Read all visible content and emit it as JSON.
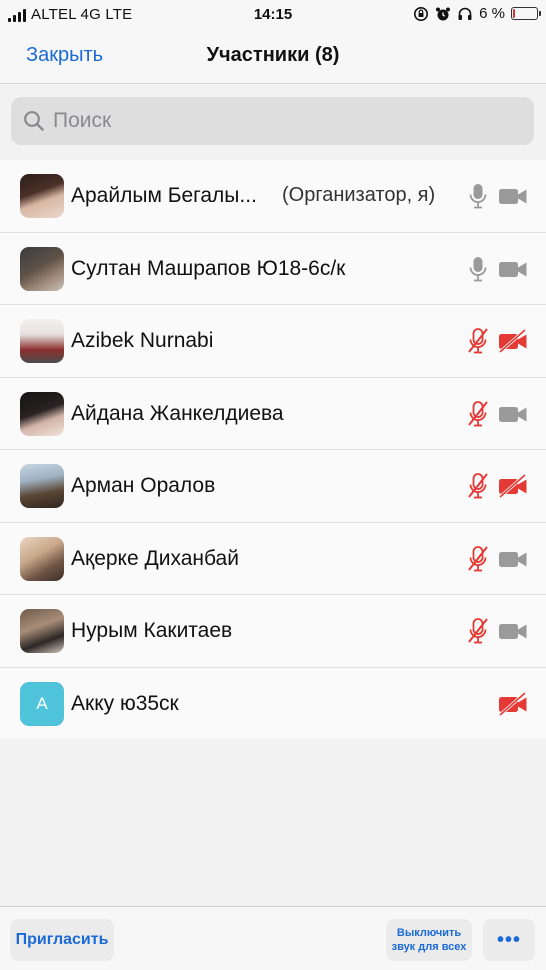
{
  "status_bar": {
    "carrier": "ALTEL 4G  LTE",
    "time": "14:15",
    "battery": "6 %",
    "battery_level": 0.06,
    "icons": [
      "signal-icon",
      "rotation-lock-icon",
      "alarm-icon",
      "headphones-icon",
      "battery-icon"
    ]
  },
  "nav": {
    "close_label": "Закрыть",
    "title": "Участники (8)"
  },
  "search": {
    "placeholder": "Поиск"
  },
  "participants": [
    {
      "name": "Арайлым Бегалы...",
      "role": "(Организатор, я)",
      "mic": "on",
      "video": "off",
      "avatar": "photo"
    },
    {
      "name": "Султан Машрапов Ю18-6с/к",
      "role": "",
      "mic": "on",
      "video": "off",
      "avatar": "photo"
    },
    {
      "name": "Azibek Nurnabi",
      "role": "",
      "mic": "muted",
      "video": "muted",
      "avatar": "photo"
    },
    {
      "name": "Айдана Жанкелдиева",
      "role": "",
      "mic": "muted",
      "video": "off",
      "avatar": "photo"
    },
    {
      "name": "Арман Оралов",
      "role": "",
      "mic": "muted",
      "video": "muted",
      "avatar": "photo"
    },
    {
      "name": "Ақерке Диханбай",
      "role": "",
      "mic": "muted",
      "video": "off",
      "avatar": "photo"
    },
    {
      "name": "Нурым Какитаев",
      "role": "",
      "mic": "muted",
      "video": "off",
      "avatar": "photo"
    },
    {
      "name": "Акку ю35ск",
      "role": "",
      "mic": "none",
      "video": "muted",
      "avatar": "initial",
      "initial": "A"
    }
  ],
  "bottom": {
    "invite_label": "Пригласить",
    "mute_all_label_line1": "Выключить",
    "mute_all_label_line2": "звук для всех",
    "more_label": "•••"
  },
  "colors": {
    "accent": "#1a6ad8",
    "muted_red": "#e53935",
    "icon_gray": "#9a9a9a",
    "initial_avatar": "#4fc3d9"
  }
}
